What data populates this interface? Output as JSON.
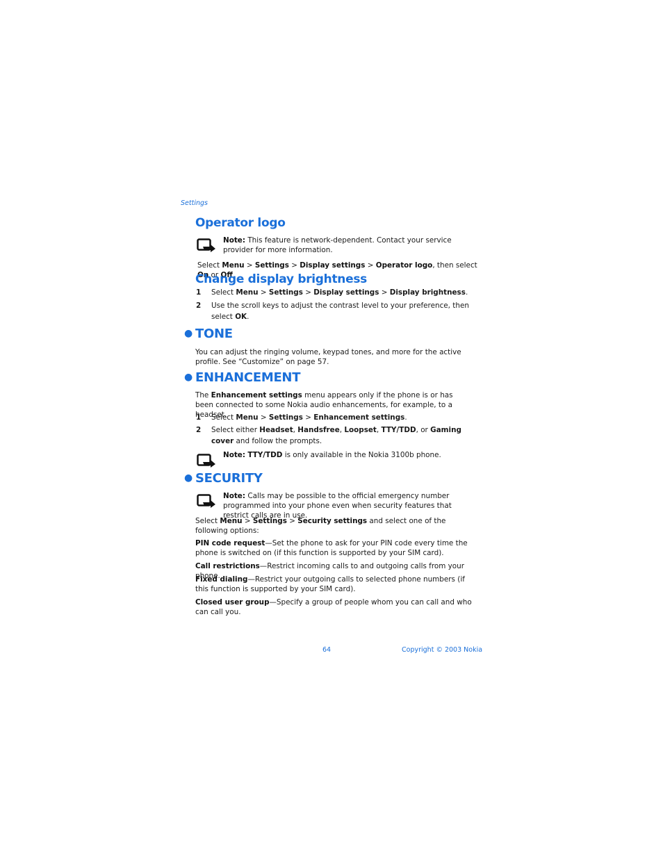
{
  "running_header": "Settings",
  "sections": {
    "operator_logo": {
      "title": "Operator logo",
      "note": {
        "label": "Note:",
        "text": "This feature is network-dependent. Contact your service provider for more information."
      },
      "instruction": {
        "t1": "Select ",
        "b1": "Menu",
        "t2": " > ",
        "b2": "Settings",
        "t3": " > ",
        "b3": "Display settings",
        "t4": " > ",
        "b4": "Operator logo",
        "t5": ", then select ",
        "b5": "On",
        "t6": " or ",
        "b6": "Off",
        "t7": "."
      }
    },
    "display_brightness": {
      "title": "Change display brightness",
      "steps": [
        {
          "num": "1",
          "t1": "Select ",
          "b1": "Menu",
          "t2": " > ",
          "b2": "Settings",
          "t3": " > ",
          "b3": "Display settings",
          "t4": " > ",
          "b4": "Display brightness",
          "t5": "."
        },
        {
          "num": "2",
          "t1": "Use the scroll keys to adjust the contrast level to your preference, then select ",
          "b1": "OK",
          "t2": "."
        }
      ]
    },
    "tone": {
      "title": "TONE",
      "body": "You can adjust the ringing volume, keypad tones, and more for the active profile. See “Customize” on page 57."
    },
    "enhancement": {
      "title": "ENHANCEMENT",
      "intro": {
        "t1": "The ",
        "b1": "Enhancement settings",
        "t2": " menu appears only if the phone is or has been connected to some Nokia audio enhancements, for example, to a headset."
      },
      "steps": [
        {
          "num": "1",
          "t1": "Select ",
          "b1": "Menu",
          "t2": " > ",
          "b2": "Settings",
          "t3": " > ",
          "b3": "Enhancement settings",
          "t4": "."
        },
        {
          "num": "2",
          "t1": "Select either ",
          "b1": "Headset",
          "t2": ", ",
          "b2": "Handsfree",
          "t3": ", ",
          "b3": "Loopset",
          "t4": ", ",
          "b4": "TTY/TDD",
          "t5": ", or ",
          "b5": "Gaming cover",
          "t6": " and follow the prompts."
        }
      ],
      "note": {
        "label": "Note:",
        "b1": "TTY/TDD",
        "text": " is only available in the Nokia 3100b phone."
      }
    },
    "security": {
      "title": "SECURITY",
      "note": {
        "label": "Note:",
        "text": "Calls may be possible to the official emergency number programmed into your phone even when security features that restrict calls are in use."
      },
      "intro": {
        "t1": "Select ",
        "b1": "Menu",
        "t2": " > ",
        "b2": "Settings",
        "t3": " > ",
        "b3": "Security settings",
        "t4": " and select one of the following options:"
      },
      "options": [
        {
          "term": "PIN code request",
          "desc": "—Set the phone to ask for your PIN code every time the phone is switched on (if this function is supported by your SIM card)."
        },
        {
          "term": "Call restrictions",
          "desc": "—Restrict incoming calls to and outgoing calls from your phone."
        },
        {
          "term": "Fixed dialing",
          "desc": "—Restrict your outgoing calls to selected phone numbers (if this function is supported by your SIM card)."
        },
        {
          "term": "Closed user group",
          "desc": "—Specify a group of people whom you can call and who can call you."
        }
      ]
    }
  },
  "footer": {
    "page_number": "64",
    "copyright": "Copyright © 2003 Nokia"
  },
  "colors": {
    "accent": "#1a6fd9",
    "text": "#1a1a1a"
  }
}
